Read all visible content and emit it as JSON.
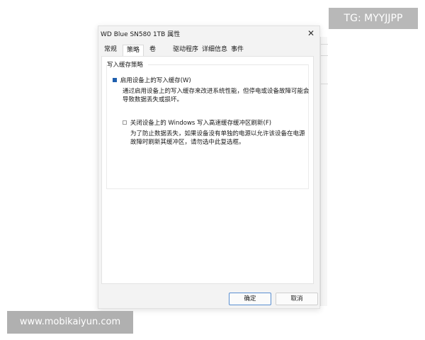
{
  "window": {
    "title": "WD Blue SN580 1TB 属性",
    "close_glyph": "✕"
  },
  "tabs": [
    {
      "label": "常规",
      "active": false
    },
    {
      "label": "策略",
      "active": true
    },
    {
      "label": "卷",
      "active": false
    },
    {
      "label": "驱动程序",
      "active": false
    },
    {
      "label": "详细信息",
      "active": false
    },
    {
      "label": "事件",
      "active": false
    }
  ],
  "policy": {
    "group_label": "写入缓存策略",
    "option1": {
      "label": "启用设备上的写入缓存(W)",
      "checked": true,
      "desc_line1": "通过启用设备上的写入缓存来改进系统性能，但停电或设备故障可能会",
      "desc_line2": "导致数据丢失或损坏。"
    },
    "option2": {
      "label": "关闭设备上的 Windows 写入高速缓存缓冲区刷新(F)",
      "checked": false,
      "desc_line1": "为了防止数据丢失，如果设备没有单独的电源以允许该设备在电源",
      "desc_line2": "故障时刷新其缓冲区，请勿选中此复选框。"
    }
  },
  "buttons": {
    "ok": "确定",
    "cancel": "取消"
  },
  "overlays": {
    "tg": "TG: MYYJJPP",
    "url": "www.mobikaiyun.com"
  },
  "colors": {
    "accent": "#1f5fae",
    "dialog_bg": "#f3f3f3",
    "overlay_bg": "#b8b8b8"
  }
}
